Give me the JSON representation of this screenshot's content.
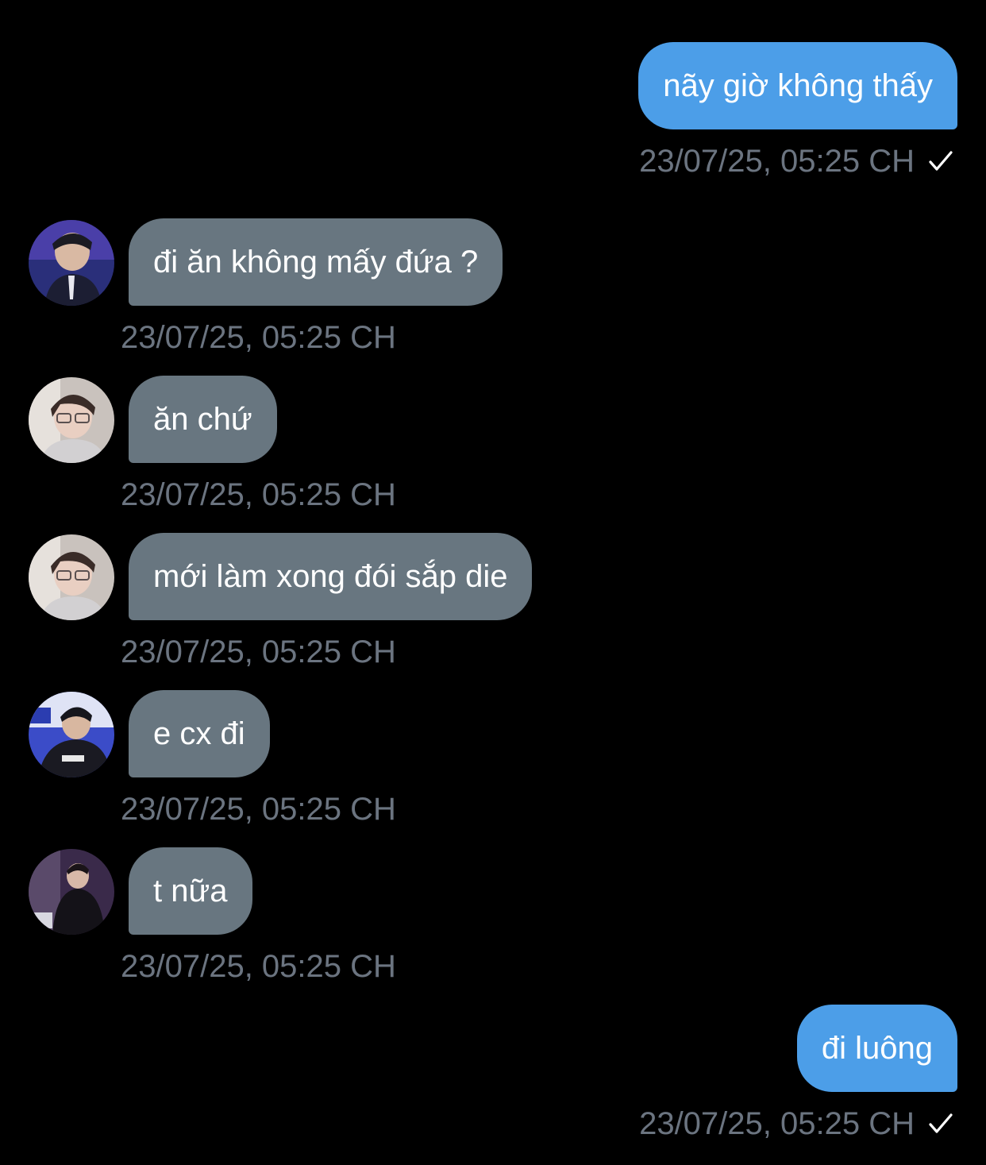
{
  "messages": [
    {
      "text": "nãy giờ không thấy",
      "time": "23/07/25, 05:25 CH"
    },
    {
      "text": "đi ăn không mấy đứa ?",
      "time": "23/07/25, 05:25 CH"
    },
    {
      "text": "ăn chứ",
      "time": "23/07/25, 05:25 CH"
    },
    {
      "text": "mới làm xong đói sắp die",
      "time": "23/07/25, 05:25 CH"
    },
    {
      "text": "e cx đi",
      "time": "23/07/25, 05:25 CH"
    },
    {
      "text": "t nữa",
      "time": "23/07/25, 05:25 CH"
    },
    {
      "text": "đi luông",
      "time": "23/07/25, 05:25 CH"
    }
  ],
  "colors": {
    "background": "#000000",
    "outgoing_bubble": "#4c9ee8",
    "incoming_bubble": "#687680",
    "timestamp": "#6b7480"
  }
}
